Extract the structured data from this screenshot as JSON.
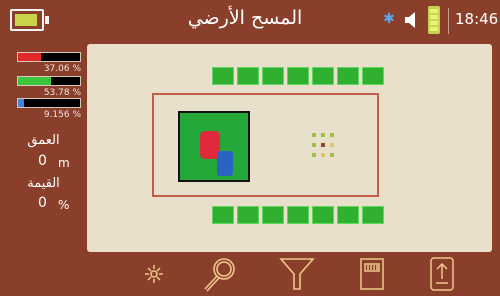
{
  "status_bar": {
    "title": "المسح الأرضي",
    "time": "18:46",
    "icons": {
      "device_battery": "battery-icon",
      "bluetooth": "bluetooth-icon",
      "sound": "speaker-icon",
      "phone_battery": "phone-battery-icon"
    }
  },
  "side_panel": {
    "signal_bars": [
      {
        "name": "red",
        "value_pct": 37.06,
        "label": "37.06 %",
        "color": "#e02a2a"
      },
      {
        "name": "green",
        "value_pct": 53.78,
        "label": "53.78 %",
        "color": "#3cc43c"
      },
      {
        "name": "blue",
        "value_pct": 9.156,
        "label": "9.156 %",
        "color": "#3a8ad8"
      }
    ],
    "depth_label": "العمق",
    "depth_value": "0",
    "depth_unit": "m",
    "value_label": "القيمة",
    "value_value": "0",
    "value_unit": "%"
  },
  "toolbar": {
    "items": [
      {
        "icon": "sun-icon"
      },
      {
        "icon": "magnifier-icon"
      },
      {
        "icon": "filter-icon"
      },
      {
        "icon": "sd-card-icon"
      },
      {
        "icon": "export-icon"
      }
    ]
  },
  "colors": {
    "frame": "#8a3f2a",
    "map_background": "#e8e0ca",
    "grid_cell": "#2fb02f",
    "scan_outline": "#c45d4a",
    "target_object": "#25a83a",
    "toolbar_icon": "#f0c98a"
  }
}
